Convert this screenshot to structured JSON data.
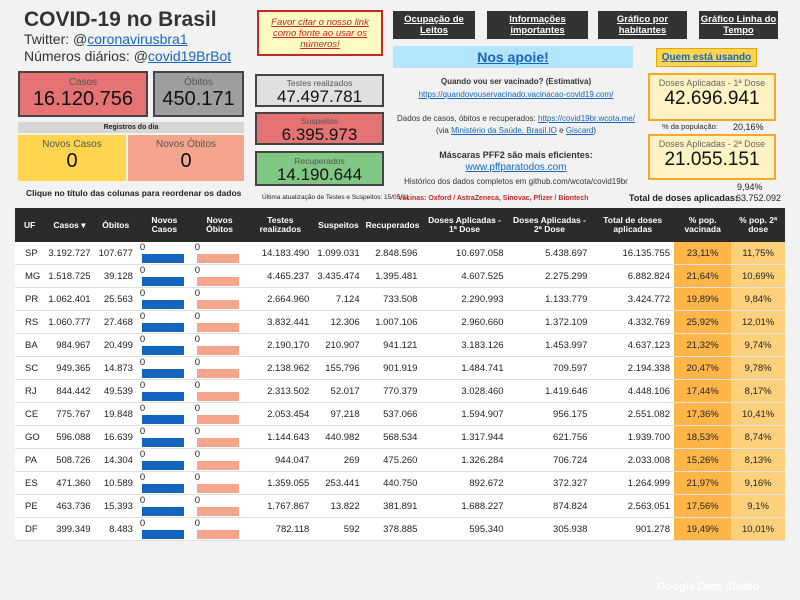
{
  "header": {
    "title": "COVID-19 no Brasil",
    "twitter_prefix": "Twitter: @",
    "twitter_handle": "coronavirusbra1",
    "daily_prefix": "Números diários: @",
    "daily_handle": "covid19BrBot",
    "cite_notice": "Favor citar o nosso link como fonte ao usar os números!"
  },
  "nav": {
    "ocupacao": "Ocupação de Leitos",
    "informacoes": "Informações importantes",
    "grafico_hab": "Gráfico por habitantes",
    "grafico_linha": "Gráfico Linha do Tempo",
    "apoie": "Nos apoie!",
    "quem": "Quem está usando"
  },
  "stats": {
    "casos_label": "Casos",
    "casos_value": "16.120.756",
    "obitos_label": "Óbitos",
    "obitos_value": "450.171",
    "registros_label": "Registros do dia",
    "novos_casos_label": "Novos Casos",
    "novos_casos_value": "0",
    "novos_obitos_label": "Novos Óbitos",
    "novos_obitos_value": "0",
    "testes_label": "Testes realizados",
    "testes_value": "47.497.781",
    "suspeitos_label": "Suspeitos",
    "suspeitos_value": "6.395.973",
    "recuperados_label": "Recuperados",
    "recuperados_value": "14.190.644",
    "doses1_label": "Doses Aplicadas - 1ª Dose",
    "doses1_value": "42.696.941",
    "pct_pop_label": "% da população:",
    "pct_pop_value": "20,16%",
    "doses2_label": "Doses Aplicadas - 2ª Dose",
    "doses2_value": "21.055.151",
    "pct_pop2_value": "9,94%",
    "total_doses_label": "Total de doses aplicadas:",
    "total_doses_value": "63.752.092"
  },
  "info": {
    "sort_hint": "Clique no título das colunas para reordenar os dados",
    "update_note": "Última atualização de Testes e Suspeitos: 15/05/21",
    "vaccine_q": "Quando vou ser vacinado? (Estimativa)",
    "vaccine_link": "https://quandovouservacinado.vacinacao-covid19.com/",
    "data_source_prefix": "Dados de casos, óbitos e recuperados:",
    "data_source_link": "https://covid19br.wcota.me/",
    "via_open": "(via ",
    "via_link1": "Ministério da Saúde, Brasil.IO",
    "via_and": " e ",
    "via_link2": "Giscard",
    "via_close": ")",
    "masks": "Máscaras PFF2 são mais eficientes:",
    "masks_link": "www.pffparatodos.com",
    "history": "Histórico dos dados completos em github.com/wcota/covid19br",
    "vaccines": "Vacinas: Oxford / AstraZeneca, Sinovac, Pfizer / Biontech",
    "brand": "Google Data Studio"
  },
  "table": {
    "headers": [
      "UF",
      "Casos ▾",
      "Óbitos",
      "Novos Casos",
      "Novos Óbitos",
      "Testes realizados",
      "Suspeitos",
      "Recuperados",
      "Doses Aplicadas - 1ª Dose",
      "Doses Aplicadas - 2ª Dose",
      "Total de doses aplicadas",
      "% pop. vacinada",
      "% pop. 2ª dose"
    ],
    "rows": [
      [
        "SP",
        "3.192.727",
        "107.677",
        "0",
        "0",
        "14.183.490",
        "1.099.031",
        "2.848.596",
        "10.697.058",
        "5.438.697",
        "16.135.755",
        "23,11%",
        "11,75%"
      ],
      [
        "MG",
        "1.518.725",
        "39.128",
        "0",
        "0",
        "4.465.237",
        "3.435.474",
        "1.395.481",
        "4.607.525",
        "2.275.299",
        "6.882.824",
        "21,64%",
        "10,69%"
      ],
      [
        "PR",
        "1.062.401",
        "25.563",
        "0",
        "0",
        "2.664.960",
        "7.124",
        "733.508",
        "2.290.993",
        "1.133.779",
        "3.424.772",
        "19,89%",
        "9,84%"
      ],
      [
        "RS",
        "1.060.777",
        "27.468",
        "0",
        "0",
        "3.832.441",
        "12.306",
        "1.007.106",
        "2.960.660",
        "1.372.109",
        "4.332.769",
        "25,92%",
        "12,01%"
      ],
      [
        "BA",
        "984.967",
        "20.499",
        "0",
        "0",
        "2.190.170",
        "210.907",
        "941.121",
        "3.183.126",
        "1.453.997",
        "4.637.123",
        "21,32%",
        "9,74%"
      ],
      [
        "SC",
        "949.365",
        "14.873",
        "0",
        "0",
        "2.138.962",
        "155.796",
        "901.919",
        "1.484.741",
        "709.597",
        "2.194.338",
        "20,47%",
        "9,78%"
      ],
      [
        "RJ",
        "844.442",
        "49.539",
        "0",
        "0",
        "2.313.502",
        "52.017",
        "770.379",
        "3.028.460",
        "1.419.646",
        "4.448.106",
        "17,44%",
        "8,17%"
      ],
      [
        "CE",
        "775.767",
        "19.848",
        "0",
        "0",
        "2.053.454",
        "97.218",
        "537.066",
        "1.594.907",
        "956.175",
        "2.551.082",
        "17,36%",
        "10,41%"
      ],
      [
        "GO",
        "596.088",
        "16.639",
        "0",
        "0",
        "1.144.643",
        "440.982",
        "568.534",
        "1.317.944",
        "621.756",
        "1.939.700",
        "18,53%",
        "8,74%"
      ],
      [
        "PA",
        "508.726",
        "14.304",
        "0",
        "0",
        "944.047",
        "269",
        "475.260",
        "1.326.284",
        "706.724",
        "2.033.008",
        "15,26%",
        "8,13%"
      ],
      [
        "ES",
        "471.360",
        "10.589",
        "0",
        "0",
        "1.359.055",
        "253.441",
        "440.750",
        "892.672",
        "372.327",
        "1.264.999",
        "21,97%",
        "9,16%"
      ],
      [
        "PE",
        "463.736",
        "15.393",
        "0",
        "0",
        "1.767.867",
        "13.822",
        "381.891",
        "1.688.227",
        "874.824",
        "2.563.051",
        "17,56%",
        "9,1%"
      ],
      [
        "DF",
        "399.349",
        "8.483",
        "0",
        "0",
        "782.118",
        "592",
        "378.885",
        "595.340",
        "305.938",
        "901.278",
        "19,49%",
        "10,01%"
      ]
    ]
  },
  "colors": {
    "novos_casos_bar": "#1565c0",
    "novos_obitos_bar": "#f4a58c",
    "pct1": "#ffb547",
    "pct2": "#fdd17c"
  }
}
